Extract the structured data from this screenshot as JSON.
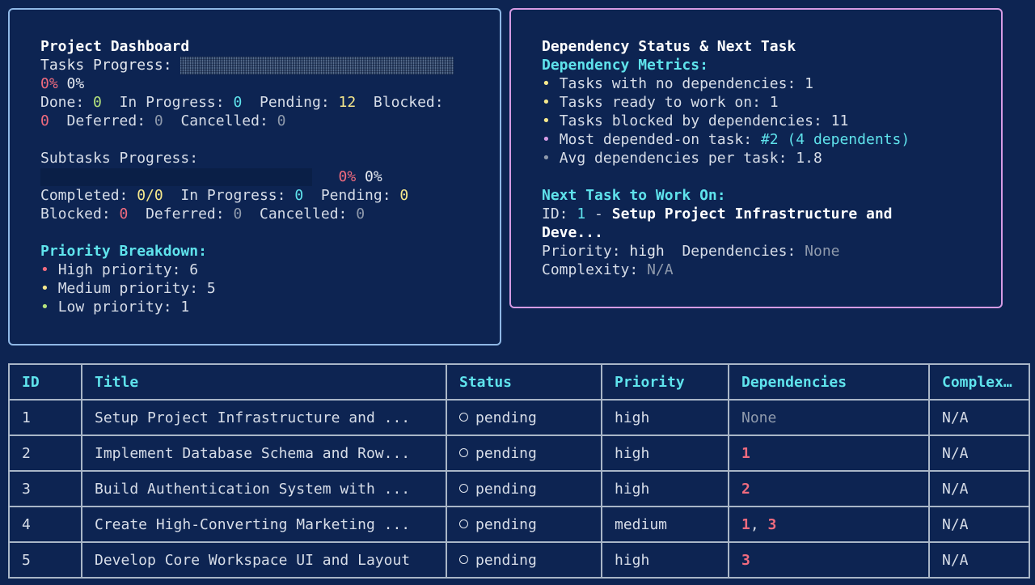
{
  "dashboard": {
    "title": "Project Dashboard",
    "tasks_progress_label": "Tasks Progress:",
    "tasks_progress_value": 0,
    "tasks_percent_red": "0%",
    "tasks_percent": "0%",
    "status_labels": {
      "done": "Done:",
      "in_progress": "In Progress:",
      "pending": "Pending:",
      "blocked": "Blocked:",
      "deferred": "Deferred:",
      "cancelled": "Cancelled:"
    },
    "task_counts": {
      "done": "0",
      "in_progress": "0",
      "pending": "12",
      "blocked": "0",
      "deferred": "0",
      "cancelled": "0"
    },
    "subtasks_progress_label": "Subtasks Progress:",
    "subtasks_progress_value": 0,
    "subtasks_percent_red": "0%",
    "subtasks_percent": "0%",
    "subtask_labels": {
      "completed": "Completed:",
      "in_progress": "In Progress:",
      "pending": "Pending:",
      "blocked": "Blocked:",
      "deferred": "Deferred:",
      "cancelled": "Cancelled:"
    },
    "subtask_counts": {
      "completed": "0/0",
      "in_progress": "0",
      "pending": "0",
      "blocked": "0",
      "deferred": "0",
      "cancelled": "0"
    },
    "priority_heading": "Priority Breakdown:",
    "priorities": [
      {
        "label": "High priority: 6",
        "bullet": "•"
      },
      {
        "label": "Medium priority: 5",
        "bullet": "•"
      },
      {
        "label": "Low priority: 1",
        "bullet": "•"
      }
    ]
  },
  "dependency": {
    "title": "Dependency Status & Next Task",
    "metrics_heading": "Dependency Metrics:",
    "metrics": [
      {
        "label": "Tasks with no dependencies: 1"
      },
      {
        "label": "Tasks ready to work on: 1"
      },
      {
        "label": "Tasks blocked by dependencies: 11"
      },
      {
        "label": "Most depended-on task: ",
        "highlight": "#2 (4 dependents)"
      },
      {
        "label": "Avg dependencies per task: 1.8"
      }
    ],
    "bullet": "•",
    "next_heading": "Next Task to Work On:",
    "next_id_label": "ID:",
    "next_id": "1",
    "next_sep": "-",
    "next_title_line1": "Setup Project Infrastructure and",
    "next_title_line2": "Deve...",
    "priority_label": "Priority:",
    "priority_value": "high",
    "dependencies_label": "Dependencies:",
    "dependencies_value": "None",
    "complexity_label": "Complexity:",
    "complexity_value": "N/A"
  },
  "table": {
    "headers": [
      "ID",
      "Title",
      "Status",
      "Priority",
      "Dependencies",
      "Complex…"
    ],
    "rows": [
      {
        "id": "1",
        "title": "Setup Project Infrastructure and ...",
        "status": "pending",
        "priority": "high",
        "deps": [],
        "deps_text": "None",
        "complexity": "N/A"
      },
      {
        "id": "2",
        "title": "Implement Database Schema and Row...",
        "status": "pending",
        "priority": "high",
        "deps": [
          "1"
        ],
        "complexity": "N/A"
      },
      {
        "id": "3",
        "title": "Build Authentication System with ...",
        "status": "pending",
        "priority": "high",
        "deps": [
          "2"
        ],
        "complexity": "N/A"
      },
      {
        "id": "4",
        "title": "Create High-Converting Marketing ...",
        "status": "pending",
        "priority": "medium",
        "deps": [
          "1",
          "3"
        ],
        "complexity": "N/A"
      },
      {
        "id": "5",
        "title": "Develop Core Workspace UI and Layout",
        "status": "pending",
        "priority": "high",
        "deps": [
          "3"
        ],
        "complexity": "N/A"
      }
    ]
  },
  "colors": {
    "background": "#0d2452",
    "left_panel_border": "#8fb8e6",
    "right_panel_border": "#d59be4",
    "heading_cyan": "#5fe3ec",
    "pending_yellow": "#f6e88c",
    "high_pink": "#f38aa0",
    "dep_red": "#f06b7e"
  }
}
